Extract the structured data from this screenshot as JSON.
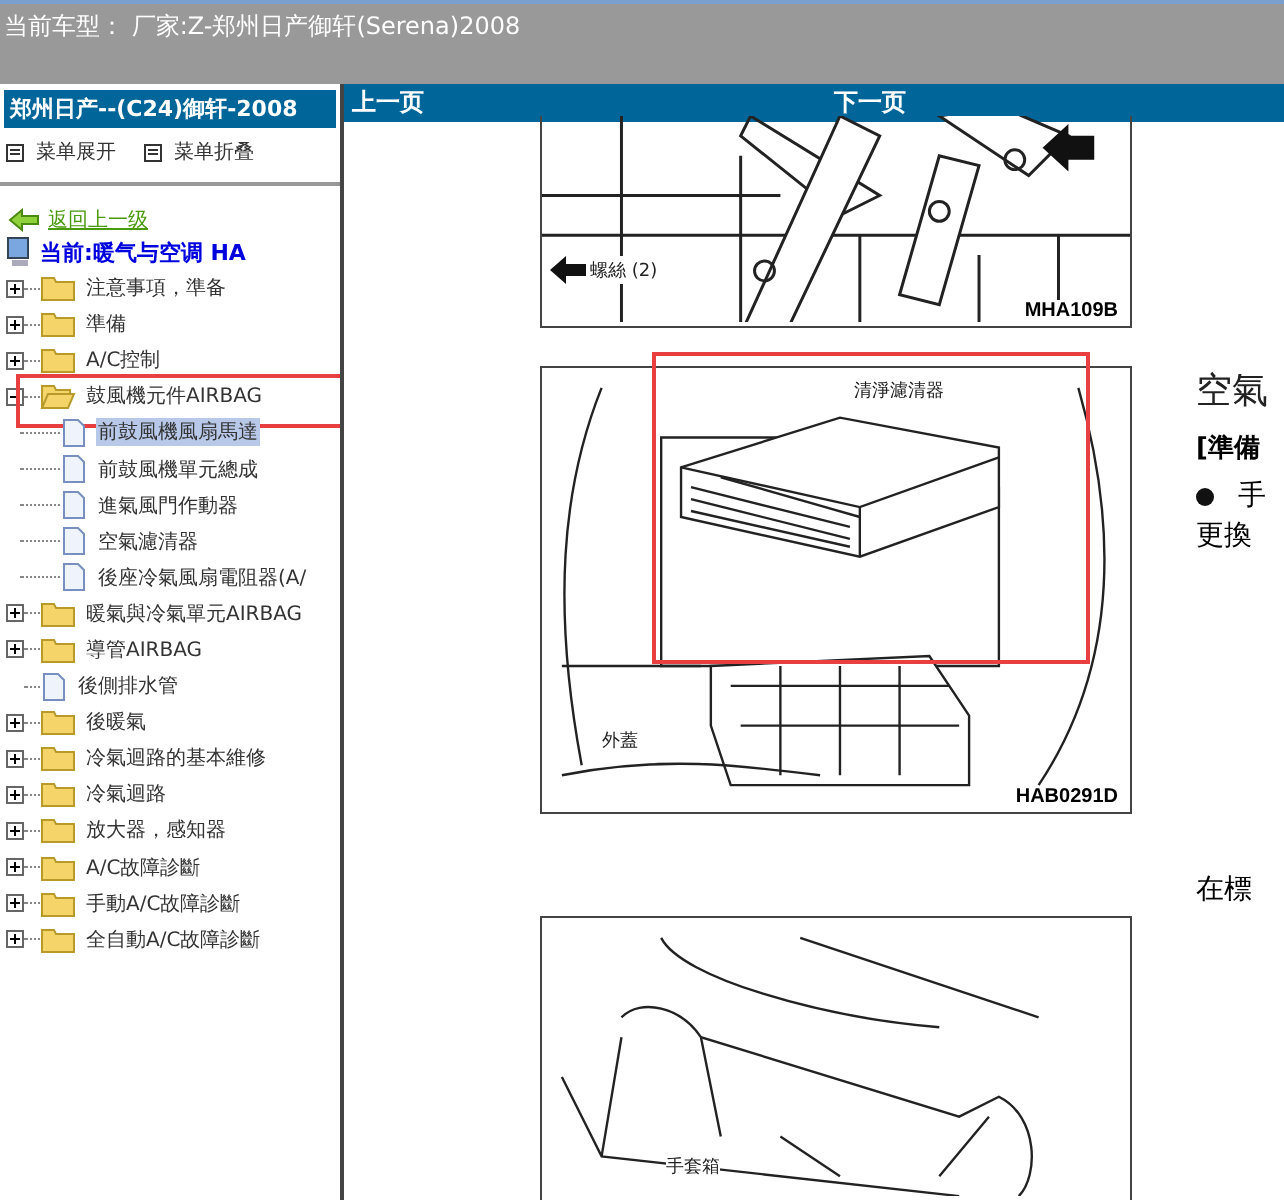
{
  "title_bar": {
    "text": "当前车型： 厂家:Z-郑州日产御轩(Serena)2008"
  },
  "sidebar": {
    "header": "郑州日产--(C24)御轩-2008",
    "menu_buttons": [
      "菜单展开",
      "菜单折叠"
    ],
    "back_link": "返回上一级",
    "current": "当前:暖气与空调 HA",
    "tree": [
      {
        "label": "注意事項，準备",
        "kind": "folder",
        "expanded": false,
        "annotated": false
      },
      {
        "label": "準備",
        "kind": "folder",
        "expanded": false,
        "annotated": false
      },
      {
        "label": "A/C控制",
        "kind": "folder",
        "expanded": false,
        "annotated": false
      },
      {
        "label": "鼓風機元件AIRBAG",
        "kind": "folder",
        "expanded": true,
        "annotated": true,
        "children": [
          {
            "label": "前鼓風機風扇馬達",
            "selected": true
          },
          {
            "label": "前鼓風機單元總成",
            "selected": false
          },
          {
            "label": "進氣風門作動器",
            "selected": false
          },
          {
            "label": "空氣濾清器",
            "selected": false
          },
          {
            "label": "後座冷氣風扇電阻器(A/",
            "selected": false
          }
        ]
      },
      {
        "label": "暖氣與冷氣單元AIRBAG",
        "kind": "folder",
        "expanded": false,
        "annotated": false
      },
      {
        "label": "導管AIRBAG",
        "kind": "folder",
        "expanded": false,
        "annotated": false
      },
      {
        "label": "後側排水管",
        "kind": "page",
        "annotated": false
      },
      {
        "label": "後暖氣",
        "kind": "folder",
        "expanded": false,
        "annotated": false
      },
      {
        "label": "冷氣迴路的基本維修",
        "kind": "folder",
        "expanded": false,
        "annotated": false
      },
      {
        "label": "冷氣迴路",
        "kind": "folder",
        "expanded": false,
        "annotated": false
      },
      {
        "label": "放大器，感知器",
        "kind": "folder",
        "expanded": false,
        "annotated": false
      },
      {
        "label": "A/C故障診斷",
        "kind": "folder",
        "expanded": false,
        "annotated": false
      },
      {
        "label": "手動A/C故障診斷",
        "kind": "folder",
        "expanded": false,
        "annotated": false
      },
      {
        "label": "全自動A/C故障診斷",
        "kind": "folder",
        "expanded": false,
        "annotated": false
      }
    ]
  },
  "nav_bar": {
    "prev": "上一页",
    "next": "下一页"
  },
  "content": [
    {
      "figure": {
        "kind": "bracket",
        "callouts": [
          "螺絲 (2)"
        ],
        "code": "MHA109B",
        "annotated": false
      }
    },
    {
      "figure": {
        "kind": "filter",
        "callouts": [
          "清淨濾清器",
          "外蓋"
        ],
        "code": "HAB0291D",
        "annotated": true
      },
      "side": [
        {
          "kind": "heading",
          "text": "空氣"
        },
        {
          "kind": "bold",
          "text": "[準備"
        },
        {
          "kind": "bullet",
          "text": "手"
        },
        {
          "kind": "text",
          "text": "更換"
        }
      ]
    },
    {
      "figure": {
        "kind": "glovebox",
        "callouts": [
          "手套箱"
        ],
        "annotated": false
      },
      "side": [
        {
          "kind": "text",
          "text": "在標"
        }
      ]
    }
  ]
}
